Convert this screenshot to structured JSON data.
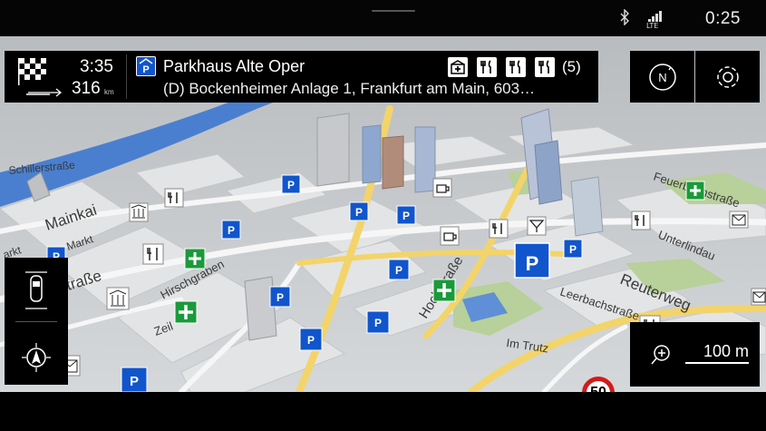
{
  "status": {
    "time": "0:25",
    "network": "LTE",
    "icons": [
      "bluetooth-icon",
      "lte-signal-icon"
    ]
  },
  "route": {
    "eta_time": "3:35",
    "distance_value": "316",
    "distance_unit": "km",
    "destination_name": "Parkhaus Alte Oper",
    "destination_address": "(D) Bockenheimer Anlage 1, Frankfurt am Main, 603…",
    "poi_icons": [
      "hospital-icon",
      "restaurant-icon",
      "restaurant-icon",
      "restaurant-icon"
    ],
    "poi_count": "(5)"
  },
  "map": {
    "street_labels": [
      {
        "id": "mainkai",
        "text": "Mainkai"
      },
      {
        "id": "schiller",
        "text": "Schillerstraße"
      },
      {
        "id": "heimer",
        "text": "heimer Straße"
      },
      {
        "id": "hirschgraben",
        "text": "Hirschgraben"
      },
      {
        "id": "zeil",
        "text": "Zeil"
      },
      {
        "id": "hochstrasse",
        "text": "Hochstraße"
      },
      {
        "id": "feuerbach",
        "text": "Feuerbachstraße"
      },
      {
        "id": "unterlindau",
        "text": "Unterlindau"
      },
      {
        "id": "reuterweg",
        "text": "Reuterweg"
      },
      {
        "id": "leerbach",
        "text": "Leerbachstraße"
      },
      {
        "id": "imtrutz",
        "text": "Im Trutz"
      },
      {
        "id": "markt",
        "text": "Markt"
      },
      {
        "id": "arkt",
        "text": "arkt"
      }
    ],
    "speed_limit": "50",
    "scale": "100 m"
  },
  "colors": {
    "panel_bg": "#000000",
    "parking_blue": "#1155cc",
    "pharmacy_green": "#1a9a3a",
    "river": "#4a7fd0",
    "speed_red": "#d21b1b"
  }
}
